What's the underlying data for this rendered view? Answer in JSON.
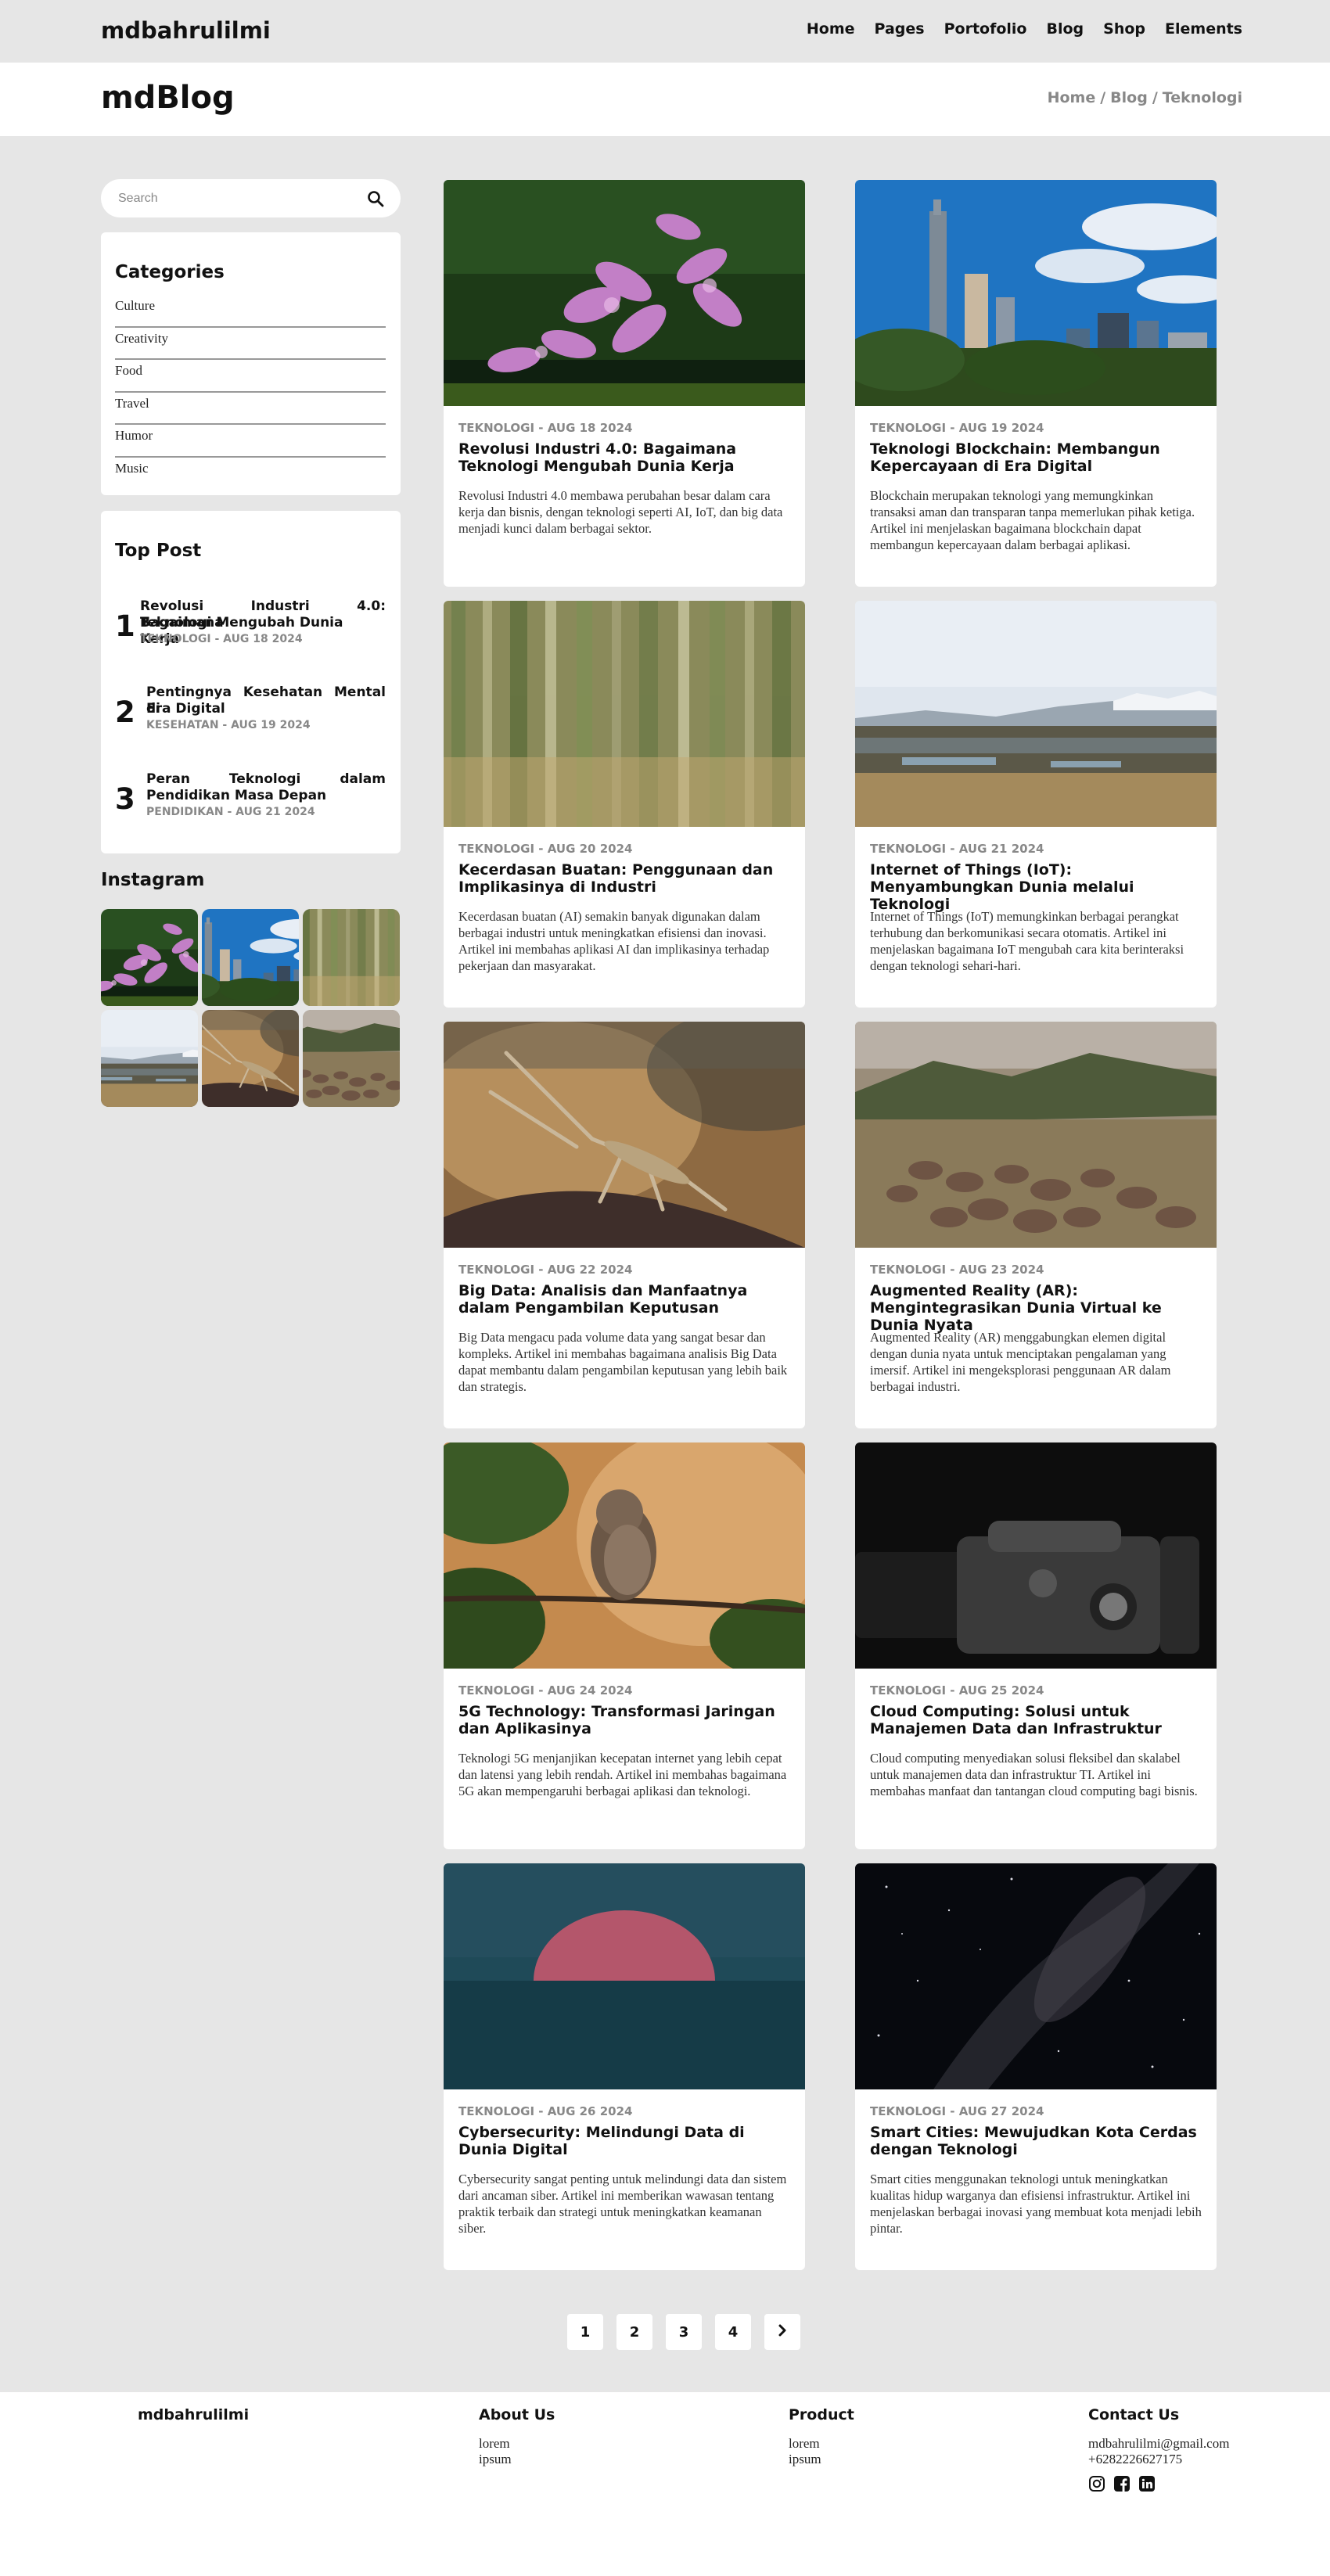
{
  "nav": {
    "brand": "mdbahrulilmi",
    "menu": [
      "Home",
      "Pages",
      "Portofolio",
      "Blog",
      "Shop",
      "Elements"
    ]
  },
  "header": {
    "title": "mdBlog",
    "breadcrumb": [
      "Home",
      "/",
      "Blog",
      "/",
      "Teknologi"
    ]
  },
  "sidebar": {
    "search_placeholder": "Search",
    "categories_title": "Categories",
    "categories": [
      "Culture",
      "Creativity",
      "Food",
      "Travel",
      "Humor",
      "Music"
    ],
    "top_post_title": "Top Post",
    "top_posts": [
      {
        "num": "1",
        "line1": "Revolusi Industri 4.0: Bagaimana",
        "line2": "Teknologi Mengubah Dunia Kerja",
        "meta": "TEKNOLOGI - AUG 18 2024"
      },
      {
        "num": "2",
        "line1": "Pentingnya Kesehatan Mental di",
        "line2": "Era Digital",
        "meta": "KESEHATAN - AUG 19 2024"
      },
      {
        "num": "3",
        "line1": "Peran Teknologi dalam",
        "line2": "Pendidikan Masa Depan",
        "meta": "PENDIDIKAN - AUG 21 2024"
      }
    ],
    "instagram_title": "Instagram"
  },
  "posts": [
    {
      "meta": "TEKNOLOGI - AUG 18 2024",
      "title": "Revolusi Industri 4.0: Bagaimana Teknologi Mengubah Dunia Kerja",
      "excerpt": "Revolusi Industri 4.0 membawa perubahan besar dalam cara kerja dan bisnis, dengan teknologi seperti AI, IoT, dan big data menjadi kunci dalam berbagai sektor."
    },
    {
      "meta": "TEKNOLOGI - AUG 19 2024",
      "title": "Teknologi Blockchain: Membangun Kepercayaan di Era Digital",
      "excerpt": "Blockchain merupakan teknologi yang memungkinkan transaksi aman dan transparan tanpa memerlukan pihak ketiga. Artikel ini menjelaskan bagaimana blockchain dapat membangun kepercayaan dalam berbagai aplikasi."
    },
    {
      "meta": "TEKNOLOGI - AUG 20 2024",
      "title": "Kecerdasan Buatan: Penggunaan dan Implikasinya di Industri",
      "excerpt": "Kecerdasan buatan (AI) semakin banyak digunakan dalam berbagai industri untuk meningkatkan efisiensi dan inovasi. Artikel ini membahas aplikasi AI dan implikasinya terhadap pekerjaan dan masyarakat."
    },
    {
      "meta": "TEKNOLOGI - AUG 21 2024",
      "title": "Internet of Things (IoT): Menyambungkan Dunia melalui Teknologi",
      "excerpt": "Internet of Things (IoT) memungkinkan berbagai perangkat terhubung dan berkomunikasi secara otomatis. Artikel ini menjelaskan bagaimana IoT mengubah cara kita berinteraksi dengan teknologi sehari-hari."
    },
    {
      "meta": "TEKNOLOGI - AUG 22 2024",
      "title": "Big Data: Analisis dan Manfaatnya dalam Pengambilan Keputusan",
      "excerpt": "Big Data mengacu pada volume data yang sangat besar dan kompleks. Artikel ini membahas bagaimana analisis Big Data dapat membantu dalam pengambilan keputusan yang lebih baik dan strategis."
    },
    {
      "meta": "TEKNOLOGI - AUG 23 2024",
      "title": "Augmented Reality (AR): Mengintegrasikan Dunia Virtual ke Dunia Nyata",
      "excerpt": "Augmented Reality (AR) menggabungkan elemen digital dengan dunia nyata untuk menciptakan pengalaman yang imersif. Artikel ini mengeksplorasi penggunaan AR dalam berbagai industri."
    },
    {
      "meta": "TEKNOLOGI - AUG 24 2024",
      "title": "5G Technology: Transformasi Jaringan dan Aplikasinya",
      "excerpt": "Teknologi 5G menjanjikan kecepatan internet yang lebih cepat dan latensi yang lebih rendah. Artikel ini membahas bagaimana 5G akan mempengaruhi berbagai aplikasi dan teknologi."
    },
    {
      "meta": "TEKNOLOGI - AUG 25 2024",
      "title": "Cloud Computing: Solusi untuk Manajemen Data dan Infrastruktur",
      "excerpt": "Cloud computing menyediakan solusi fleksibel dan skalabel untuk manajemen data dan infrastruktur TI. Artikel ini membahas manfaat dan tantangan cloud computing bagi bisnis."
    },
    {
      "meta": "TEKNOLOGI - AUG 26 2024",
      "title": "Cybersecurity: Melindungi Data di Dunia Digital",
      "excerpt": "Cybersecurity sangat penting untuk melindungi data dan sistem dari ancaman siber. Artikel ini memberikan wawasan tentang praktik terbaik dan strategi untuk meningkatkan keamanan siber."
    },
    {
      "meta": "TEKNOLOGI - AUG 27 2024",
      "title": "Smart Cities: Mewujudkan Kota Cerdas dengan Teknologi",
      "excerpt": "Smart cities menggunakan teknologi untuk meningkatkan kualitas hidup warganya dan efisiensi infrastruktur. Artikel ini menjelaskan berbagai inovasi yang membuat kota menjadi lebih pintar."
    }
  ],
  "pagination": [
    "1",
    "2",
    "3",
    "4"
  ],
  "footer": {
    "brand": "mdbahrulilmi",
    "about_title": "About Us",
    "about_links": [
      "lorem",
      "ipsum"
    ],
    "product_title": "Product",
    "product_links": [
      "lorem",
      "ipsum"
    ],
    "contact_title": "Contact Us",
    "email": "mdbahrulilmi@gmail.com",
    "phone": "+6282226627175"
  }
}
